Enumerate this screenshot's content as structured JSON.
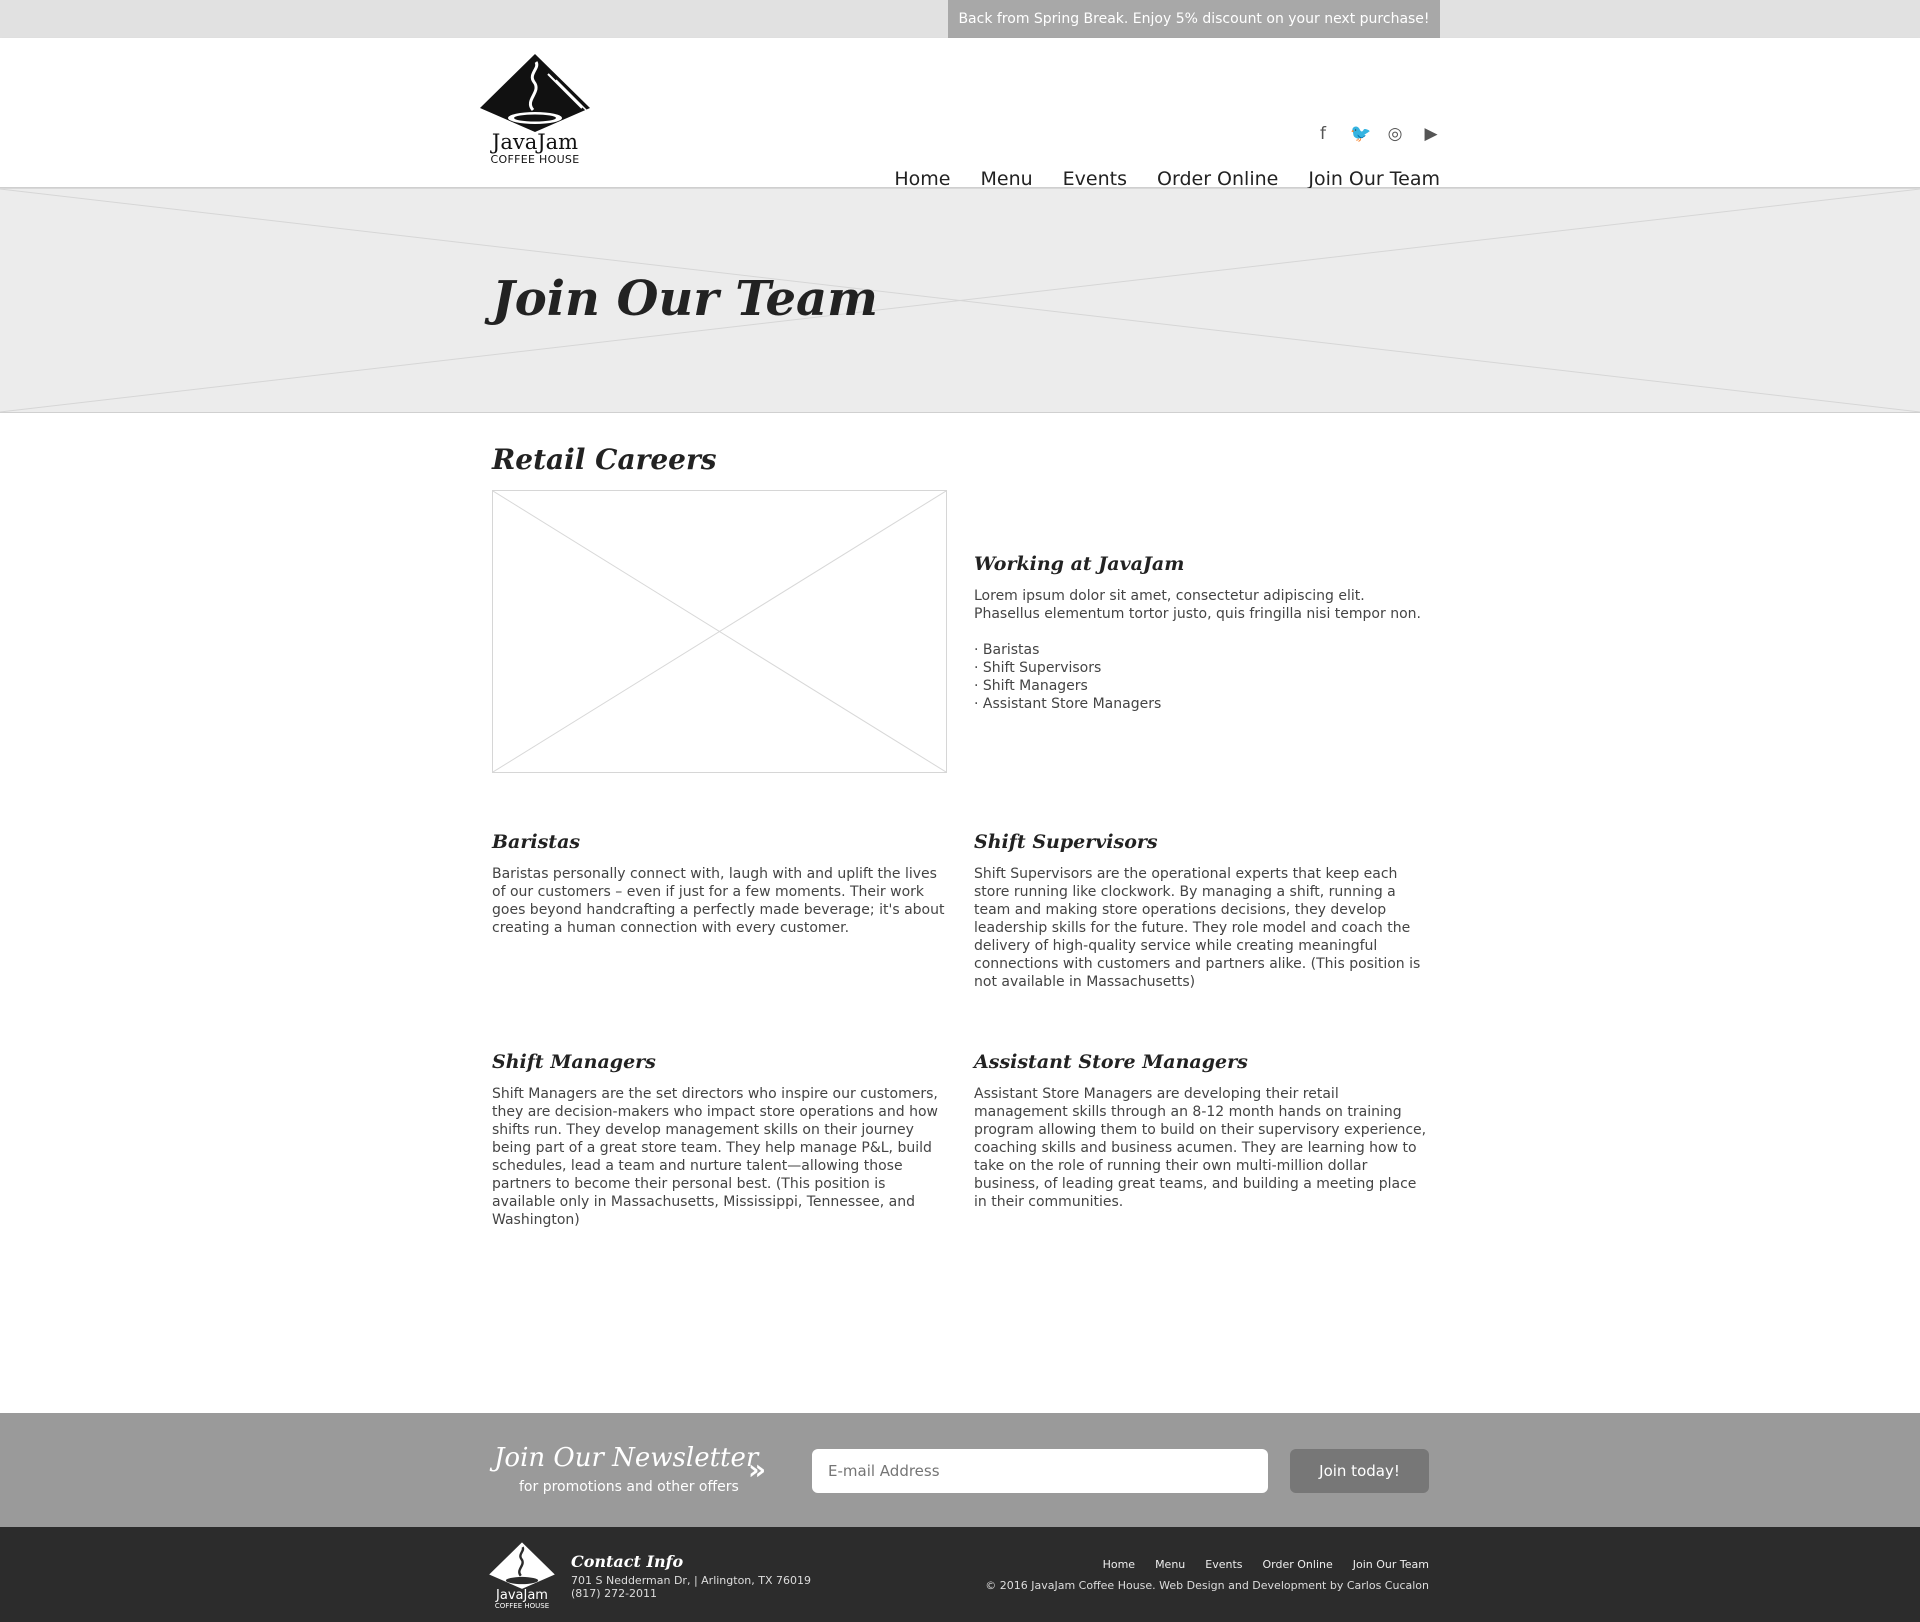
{
  "promo": {
    "text": "Back from Spring Break. Enjoy 5% discount on your next purchase!"
  },
  "brand": {
    "name": "JavaJam",
    "subtitle": "COFFEE HOUSE"
  },
  "social": [
    {
      "name": "facebook-icon",
      "glyph": "f"
    },
    {
      "name": "twitter-icon",
      "glyph": "🐦"
    },
    {
      "name": "instagram-icon",
      "glyph": "◎"
    },
    {
      "name": "youtube-icon",
      "glyph": "▶"
    }
  ],
  "nav": [
    "Home",
    "Menu",
    "Events",
    "Order Online",
    "Join Our Team"
  ],
  "hero": {
    "title": "Join Our Team"
  },
  "main": {
    "section_title": "Retail Careers",
    "working": {
      "title": "Working at JavaJam",
      "text": "Lorem ipsum dolor sit amet, consectetur adipiscing elit. Phasellus elementum tortor justo, quis fringilla nisi tempor non.",
      "list": [
        "· Baristas",
        "· Shift Supervisors",
        "· Shift Managers",
        "· Assistant Store Managers"
      ]
    },
    "cards": [
      {
        "title": "Baristas",
        "text": "Baristas personally connect with, laugh with and uplift the lives of our customers – even if just for a few moments. Their work goes beyond handcrafting a perfectly made beverage; it's about creating a human connection with every customer."
      },
      {
        "title": "Shift Supervisors",
        "text": "Shift Supervisors are the operational experts that keep each store running like clockwork. By managing a shift, running a team and making store operations decisions, they develop leadership skills for the future. They role model and coach the delivery of high-quality service while creating meaningful connections with customers and partners alike. (This position is not available in Massachusetts)"
      },
      {
        "title": "Shift Managers",
        "text": "Shift Managers are the set directors who inspire our customers, they are decision-makers who impact store operations and how shifts run. They develop management skills on their journey being part of a great store team. They help manage P&L, build schedules, lead a team and nurture talent—allowing those partners to become their personal best. (This position is available only in Massachusetts, Mississippi, Tennessee, and Washington)"
      },
      {
        "title": "Assistant Store Managers",
        "text": "Assistant Store Managers are developing their retail management skills through an 8-12 month hands on training program allowing them to build on their supervisory experience, coaching skills and business acumen. They are learning how to take on the role of running their own multi-million dollar business, of leading great teams, and building a meeting place in their communities."
      }
    ]
  },
  "newsletter": {
    "title": "Join Our Newsletter",
    "subtitle": "for promotions and other offers",
    "placeholder": "E-mail Address",
    "button": "Join today!"
  },
  "footer": {
    "contact_title": "Contact Info",
    "address": "701 S Nedderman Dr, | Arlington, TX 76019",
    "phone": "(817) 272-2011",
    "nav": [
      "Home",
      "Menu",
      "Events",
      "Order Online",
      "Join Our Team"
    ],
    "copyright": "© 2016 JavaJam Coffee House. Web Design and Development by Carlos Cucalon"
  }
}
